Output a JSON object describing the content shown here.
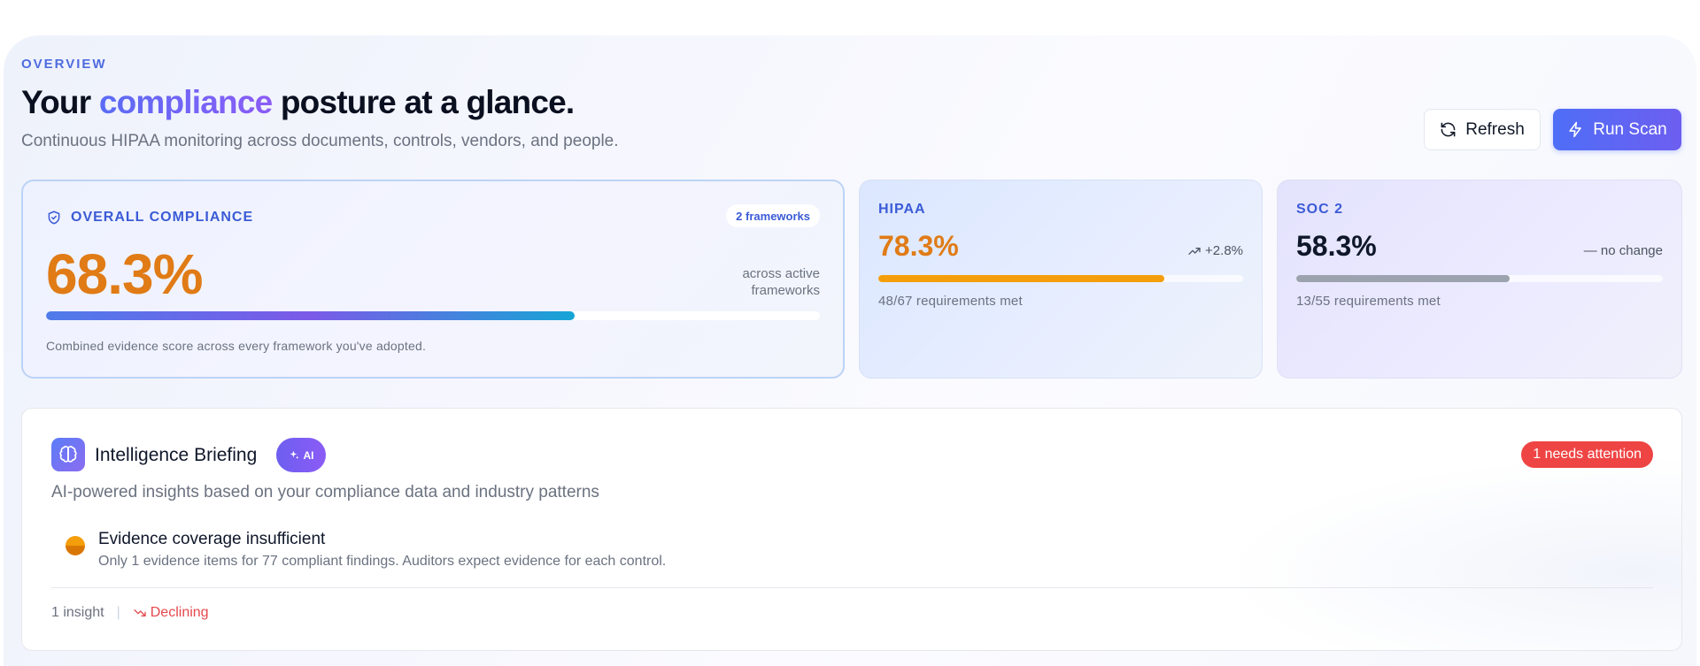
{
  "header": {
    "eyebrow": "OVERVIEW",
    "title_part1": "Your ",
    "title_accent": "compliance",
    "title_part2": " posture at a glance.",
    "subtitle": "Continuous HIPAA monitoring across documents, controls, vendors, and people."
  },
  "actions": {
    "refresh_label": "Refresh",
    "refresh_icon": "refresh-icon",
    "scan_label": "Run Scan",
    "scan_icon": "lightning-icon"
  },
  "overall": {
    "label": "OVERALL COMPLIANCE",
    "icon": "shield-icon",
    "frameworks_badge": "2 frameworks",
    "value": "68.3%",
    "progress": 68.3,
    "note": "across active frameworks",
    "description": "Combined evidence score across every framework you've adopted.",
    "value_color": "#e07b16"
  },
  "frameworks": [
    {
      "name": "HIPAA",
      "value": "78.3%",
      "progress": 78.3,
      "change": "+2.8%",
      "change_icon": "trending-up-icon",
      "requirements": "48/67 requirements met",
      "value_color": "#e07b16",
      "bar_color": "#f59e0b"
    },
    {
      "name": "SOC 2",
      "value": "58.3%",
      "progress": 58.3,
      "change": "— no change",
      "requirements": "13/55 requirements met",
      "value_color": "#0f172a",
      "bar_color": "#9ca3af"
    }
  ],
  "briefing": {
    "icon": "brain-icon",
    "title": "Intelligence Briefing",
    "ai_badge": "AI",
    "ai_icon": "sparkles-icon",
    "attention_badge": "1 needs attention",
    "subtitle": "AI-powered insights based on your compliance data and industry patterns",
    "insights": [
      {
        "title": "Evidence coverage insufficient",
        "description": "Only 1 evidence items for 77 compliant findings. Auditors expect evidence for each control.",
        "severity_color": "#f59e0b"
      }
    ],
    "footer_count": "1 insight",
    "footer_sep": "|",
    "trend_label": "Declining",
    "trend_icon": "trending-down-icon"
  },
  "colors": {
    "accent": "#4f6ef7",
    "attention": "#ef4444",
    "declining": "#e5484d"
  }
}
